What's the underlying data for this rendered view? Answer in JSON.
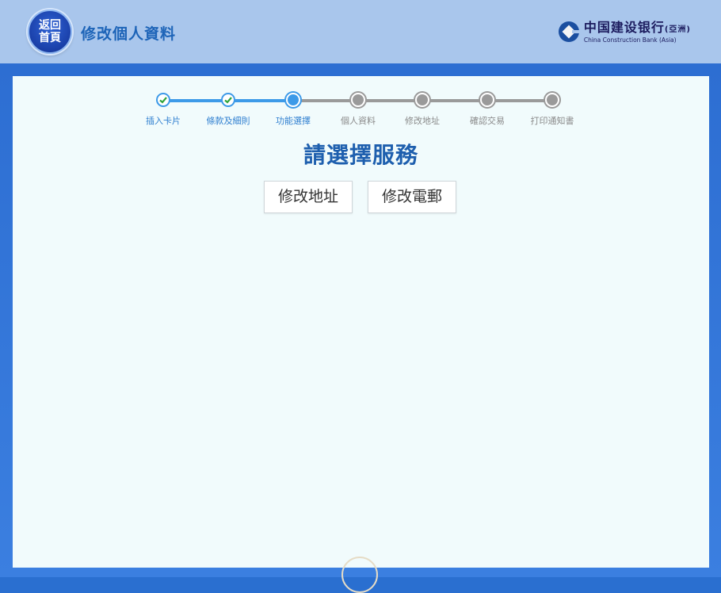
{
  "header": {
    "home_button": [
      "返回",
      "首頁"
    ],
    "title": "修改個人資料"
  },
  "logo": {
    "chinese": "中国建设银行",
    "chinese_suffix": "(亞洲)",
    "english": "China Construction Bank (Asia)"
  },
  "steps": [
    {
      "label": "插入卡片",
      "state": "done"
    },
    {
      "label": "條款及細則",
      "state": "done"
    },
    {
      "label": "功能選擇",
      "state": "current"
    },
    {
      "label": "個人資料",
      "state": "todo"
    },
    {
      "label": "修改地址",
      "state": "todo"
    },
    {
      "label": "確認交易",
      "state": "todo"
    },
    {
      "label": "打印通知書",
      "state": "todo"
    }
  ],
  "main": {
    "heading": "請選擇服務",
    "options": [
      "修改地址",
      "修改電郵"
    ]
  },
  "colors": {
    "header_bg": "#a9c6ec",
    "frame_bg": "#2d6ed2",
    "panel_bg": "#f1fbfc",
    "accent": "#3d9ae8",
    "heading": "#1e5fae",
    "inactive": "#9a9a9a"
  }
}
